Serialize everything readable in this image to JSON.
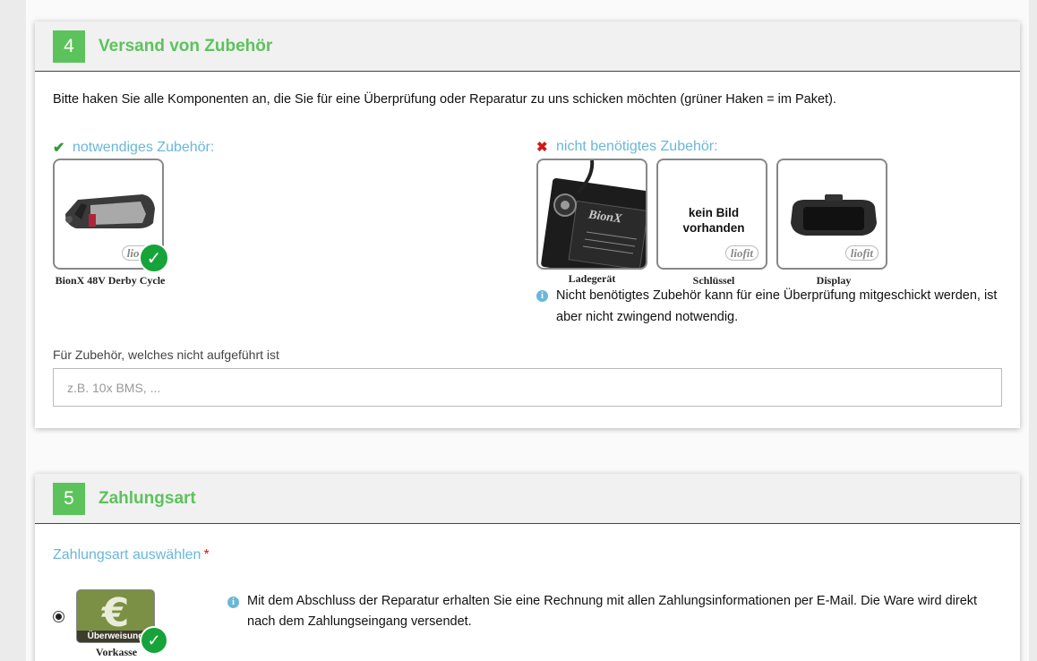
{
  "section4": {
    "number": "4",
    "title": "Versand von Zubehör",
    "intro": "Bitte haken Sie alle Komponenten an, die Sie für eine Überprüfung oder Reparatur zu uns schicken möchten (grüner Haken = im Paket).",
    "required_group": {
      "label": "notwendiges Zubehör:",
      "icon": "check-icon",
      "items": [
        {
          "caption": "BionX 48V Derby Cycle",
          "logo": "liofit",
          "checked": true
        }
      ]
    },
    "optional_group": {
      "label": "nicht benötigtes Zubehör:",
      "icon": "cross-icon",
      "items": [
        {
          "caption": "Ladegerät",
          "product_brand": "BionX",
          "checked": false
        },
        {
          "caption": "Schlüssel",
          "placeholder_text": "kein Bild vorhanden",
          "logo": "liofit",
          "checked": false
        },
        {
          "caption": "Display",
          "logo": "liofit",
          "checked": false
        }
      ],
      "note": "Nicht benötigtes Zubehör kann für eine Überprüfung mitgeschickt werden, ist aber nicht zwingend notwendig."
    },
    "other_field": {
      "label": "Für Zubehör, welches nicht aufgeführt ist",
      "placeholder": "z.B. 10x BMS, ..."
    }
  },
  "section5": {
    "number": "5",
    "title": "Zahlungsart",
    "select_label": "Zahlungsart auswählen",
    "required_mark": "*",
    "options": [
      {
        "caption": "Vorkasse",
        "tile_text": "Überweisung",
        "selected": true,
        "info": "Mit dem Abschluss der Reparatur erhalten Sie eine Rechnung mit allen Zahlungsinformationen per E-Mail. Die Ware wird direkt nach dem Zahlungseingang versendet."
      }
    ]
  },
  "colors": {
    "accent_green": "#5cc35c",
    "check_green": "#16a339",
    "label_blue": "#6ab7d8",
    "error_red": "#d01818"
  }
}
